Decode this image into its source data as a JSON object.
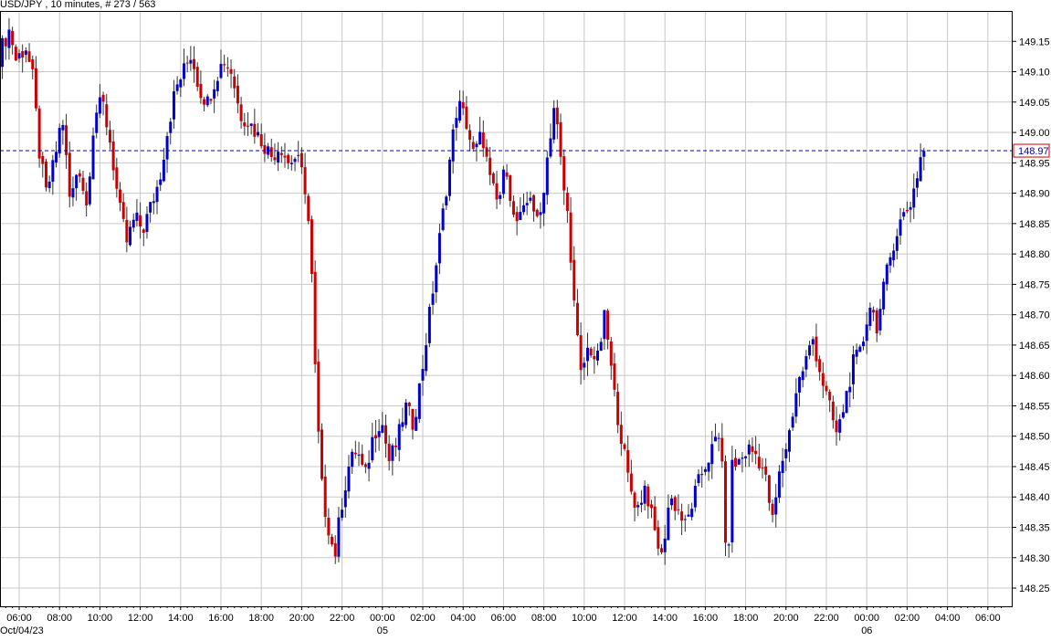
{
  "header": {
    "symbol": "USD/JPY",
    "interval": "10 minutes",
    "bars_info": "# 273 / 563"
  },
  "chart_data": {
    "type": "candlestick",
    "title": "USD/JPY , 10 minutes, # 273 / 563",
    "y_range": [
      148.22,
      149.2
    ],
    "y_ticks": [
      "149.15",
      "149.10",
      "149.05",
      "149.00",
      "148.95",
      "148.90",
      "148.85",
      "148.80",
      "148.75",
      "148.70",
      "148.65",
      "148.60",
      "148.55",
      "148.50",
      "148.45",
      "148.40",
      "148.35",
      "148.30",
      "148.25"
    ],
    "x_ticks": [
      "06:00",
      "08:00",
      "10:00",
      "12:00",
      "14:00",
      "16:00",
      "18:00",
      "20:00",
      "22:00",
      "00:00",
      "02:00",
      "04:00",
      "06:00",
      "08:00",
      "10:00",
      "12:00",
      "14:00",
      "16:00",
      "18:00",
      "20:00",
      "22:00",
      "00:00",
      "02:00",
      "04:00",
      "06:00"
    ],
    "x_tick_hours": [
      6,
      8,
      10,
      12,
      14,
      16,
      18,
      20,
      22,
      24,
      26,
      28,
      30,
      32,
      34,
      36,
      38,
      40,
      42,
      44,
      46,
      48,
      50,
      52,
      54
    ],
    "date_labels": [
      {
        "text": "Oct/04/23",
        "hour": 5.5
      },
      {
        "text": "05",
        "hour": 24
      },
      {
        "text": "06",
        "hour": 48
      }
    ],
    "current_price": "148.97",
    "grid": true,
    "colors": {
      "up": "#0000cc",
      "down": "#cc0000",
      "grid": "#c8c8c8",
      "current_line": "#0000aa"
    },
    "price_path": [
      [
        5.0,
        149.1
      ],
      [
        5.3,
        149.14
      ],
      [
        5.7,
        149.17
      ],
      [
        6.0,
        149.12
      ],
      [
        6.5,
        149.14
      ],
      [
        6.9,
        149.08
      ],
      [
        7.1,
        148.98
      ],
      [
        7.5,
        148.9
      ],
      [
        7.9,
        148.95
      ],
      [
        8.3,
        149.03
      ],
      [
        8.7,
        148.88
      ],
      [
        9.1,
        148.95
      ],
      [
        9.5,
        148.88
      ],
      [
        9.9,
        149.03
      ],
      [
        10.3,
        149.05
      ],
      [
        10.7,
        148.98
      ],
      [
        11.1,
        148.88
      ],
      [
        11.5,
        148.82
      ],
      [
        11.9,
        148.86
      ],
      [
        12.3,
        148.84
      ],
      [
        12.7,
        148.88
      ],
      [
        13.1,
        148.92
      ],
      [
        13.5,
        149.0
      ],
      [
        13.9,
        149.07
      ],
      [
        14.3,
        149.1
      ],
      [
        14.7,
        149.13
      ],
      [
        15.1,
        149.07
      ],
      [
        15.5,
        149.05
      ],
      [
        15.9,
        149.09
      ],
      [
        16.3,
        149.12
      ],
      [
        16.7,
        149.1
      ],
      [
        17.1,
        149.03
      ],
      [
        17.5,
        149.02
      ],
      [
        17.9,
        149.0
      ],
      [
        18.3,
        148.98
      ],
      [
        18.7,
        148.96
      ],
      [
        19.1,
        148.98
      ],
      [
        19.5,
        148.95
      ],
      [
        19.9,
        148.96
      ],
      [
        20.3,
        148.92
      ],
      [
        20.6,
        148.82
      ],
      [
        20.9,
        148.55
      ],
      [
        21.2,
        148.4
      ],
      [
        21.5,
        148.35
      ],
      [
        21.8,
        148.3
      ],
      [
        22.1,
        148.38
      ],
      [
        22.5,
        148.45
      ],
      [
        22.9,
        148.48
      ],
      [
        23.3,
        148.43
      ],
      [
        23.7,
        148.5
      ],
      [
        24.1,
        148.53
      ],
      [
        24.5,
        148.46
      ],
      [
        24.9,
        148.49
      ],
      [
        25.3,
        148.55
      ],
      [
        25.7,
        148.52
      ],
      [
        26.1,
        148.6
      ],
      [
        26.5,
        148.7
      ],
      [
        26.9,
        148.8
      ],
      [
        27.3,
        148.9
      ],
      [
        27.6,
        148.98
      ],
      [
        27.9,
        149.05
      ],
      [
        28.3,
        149.02
      ],
      [
        28.7,
        148.96
      ],
      [
        29.1,
        149.0
      ],
      [
        29.5,
        148.92
      ],
      [
        29.9,
        148.88
      ],
      [
        30.3,
        148.95
      ],
      [
        30.7,
        148.85
      ],
      [
        31.1,
        148.86
      ],
      [
        31.5,
        148.9
      ],
      [
        31.9,
        148.84
      ],
      [
        32.3,
        148.95
      ],
      [
        32.7,
        149.05
      ],
      [
        33.1,
        148.92
      ],
      [
        33.4,
        148.85
      ],
      [
        33.7,
        148.7
      ],
      [
        34.0,
        148.6
      ],
      [
        34.4,
        148.65
      ],
      [
        34.8,
        148.62
      ],
      [
        35.2,
        148.7
      ],
      [
        35.6,
        148.58
      ],
      [
        36.0,
        148.5
      ],
      [
        36.4,
        148.42
      ],
      [
        36.8,
        148.38
      ],
      [
        37.2,
        148.42
      ],
      [
        37.6,
        148.35
      ],
      [
        38.0,
        148.3
      ],
      [
        38.4,
        148.4
      ],
      [
        38.8,
        148.38
      ],
      [
        39.2,
        148.35
      ],
      [
        39.6,
        148.4
      ],
      [
        40.0,
        148.44
      ],
      [
        40.4,
        148.47
      ],
      [
        40.8,
        148.5
      ],
      [
        41.1,
        148.45
      ],
      [
        41.2,
        148.24
      ],
      [
        41.5,
        148.45
      ],
      [
        41.9,
        148.46
      ],
      [
        42.3,
        148.48
      ],
      [
        42.7,
        148.47
      ],
      [
        43.1,
        148.44
      ],
      [
        43.5,
        148.36
      ],
      [
        43.9,
        148.45
      ],
      [
        44.3,
        148.5
      ],
      [
        44.7,
        148.58
      ],
      [
        45.1,
        148.62
      ],
      [
        45.5,
        148.66
      ],
      [
        45.9,
        148.6
      ],
      [
        46.3,
        148.55
      ],
      [
        46.7,
        148.5
      ],
      [
        47.1,
        148.56
      ],
      [
        47.5,
        148.62
      ],
      [
        47.9,
        148.64
      ],
      [
        48.3,
        148.72
      ],
      [
        48.7,
        148.68
      ],
      [
        49.1,
        148.76
      ],
      [
        49.5,
        148.82
      ],
      [
        49.9,
        148.86
      ],
      [
        50.3,
        148.88
      ],
      [
        50.6,
        148.92
      ],
      [
        50.9,
        148.97
      ]
    ]
  }
}
